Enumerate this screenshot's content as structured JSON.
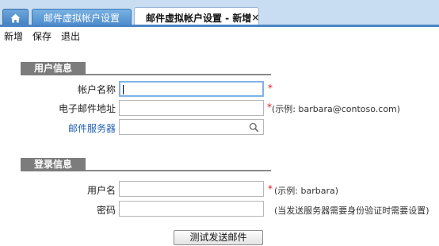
{
  "tabs": {
    "inactive_label": "邮件虚拟帐户设置",
    "active_label": "邮件虚拟帐户设置 - 新增",
    "close_glyph": "×"
  },
  "toolbar": {
    "new_label": "新增",
    "save_label": "保存",
    "exit_label": "退出"
  },
  "user_info": {
    "title": "用户信息",
    "account_name_label": "帐户名称",
    "account_name_value": "",
    "email_label": "电子邮件地址",
    "email_value": "",
    "email_hint": "(示例: barbara@contoso.com)",
    "mail_server_label": "邮件服务器",
    "mail_server_value": ""
  },
  "login_info": {
    "title": "登录信息",
    "username_label": "用户名",
    "username_value": "",
    "username_hint": "(示例: barbara)",
    "password_label": "密码",
    "password_value": "",
    "password_hint": "(当发送服务器需要身份验证时需要设置)"
  },
  "required_mark": "*",
  "test_button_label": "测试发送邮件"
}
